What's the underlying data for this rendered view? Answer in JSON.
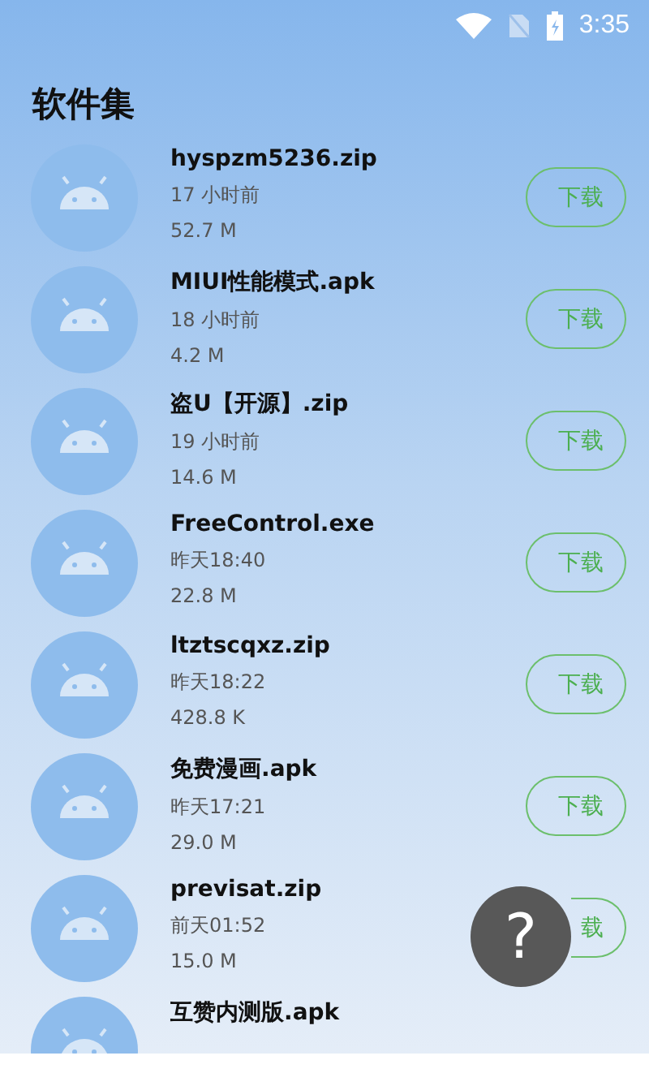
{
  "status_bar": {
    "time": "3:35"
  },
  "title": "软件集",
  "files": [
    {
      "name": "hyspzm5236.zip",
      "time": "17 小时前",
      "size": "52.7 M",
      "action": "下载"
    },
    {
      "name": "MIUI性能模式.apk",
      "time": "18 小时前",
      "size": "4.2 M",
      "action": "下载"
    },
    {
      "name": "盗U【开源】.zip",
      "time": "19 小时前",
      "size": "14.6 M",
      "action": "下载"
    },
    {
      "name": "FreeControl.exe",
      "time": "昨天18:40",
      "size": "22.8 M",
      "action": "下载"
    },
    {
      "name": "ltztscqxz.zip",
      "time": "昨天18:22",
      "size": "428.8 K",
      "action": "下载"
    },
    {
      "name": "免费漫画.apk",
      "time": "昨天17:21",
      "size": "29.0 M",
      "action": "下载"
    },
    {
      "name": "previsat.zip",
      "time": "前天01:52",
      "size": "15.0 M",
      "action": "载",
      "kind": "partial"
    },
    {
      "name": "互赞内测版.apk"
    }
  ],
  "help_button": {
    "label": "?"
  }
}
